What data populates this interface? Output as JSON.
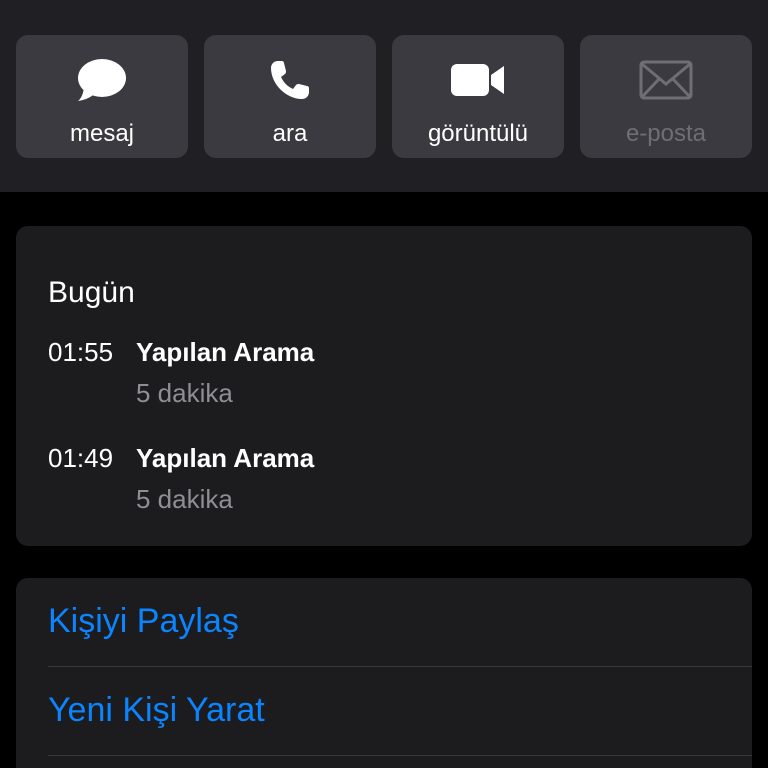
{
  "action_bar": {
    "buttons": [
      {
        "label": "mesaj",
        "icon": "message-bubble-icon",
        "enabled": true
      },
      {
        "label": "ara",
        "icon": "phone-icon",
        "enabled": true
      },
      {
        "label": "görüntülü",
        "icon": "video-camera-icon",
        "enabled": true
      },
      {
        "label": "e-posta",
        "icon": "envelope-icon",
        "enabled": false
      }
    ]
  },
  "recents": {
    "day_title": "Bugün",
    "calls": [
      {
        "time": "01:55",
        "type": "Yapılan Arama",
        "duration": "5 dakika"
      },
      {
        "time": "01:49",
        "type": "Yapılan Arama",
        "duration": "5 dakika"
      }
    ]
  },
  "contact_actions": {
    "share_label": "Kişiyi Paylaş",
    "create_label": "Yeni Kişi Yarat"
  },
  "colors": {
    "accent": "#0a84ff",
    "background": "#000000",
    "card": "#1c1c1e",
    "button": "#3a3a40",
    "secondary_text": "#8e8e93"
  }
}
